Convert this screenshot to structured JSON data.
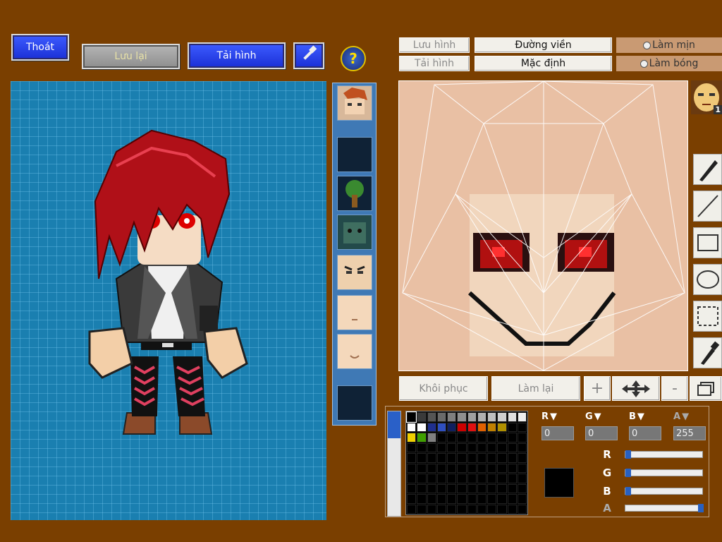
{
  "top_buttons": {
    "exit": "Thoát",
    "save": "Lưu lại",
    "load": "Tải hình",
    "help_symbol": "?"
  },
  "editor_buttons": {
    "save_image": "Lưu hình",
    "load_image": "Tải hình",
    "outline": "Đường viền",
    "default": "Mặc định",
    "smooth": "Làm mịn",
    "shiny": "Làm bóng"
  },
  "bottom_buttons": {
    "restore": "Khôi phục",
    "redo": "Làm lại",
    "zoom_in": "+",
    "zoom_out": "-"
  },
  "avatar_badge": "1",
  "color": {
    "channels": [
      {
        "label": "R",
        "value": "0"
      },
      {
        "label": "G",
        "value": "0"
      },
      {
        "label": "B",
        "value": "0"
      },
      {
        "label": "A",
        "value": "255"
      }
    ],
    "slider_levels": {
      "R": 0.0,
      "G": 0.0,
      "B": 0.0,
      "A": 1.0
    },
    "current_color": "#000000",
    "palette": [
      "#000000",
      "#3a3a3a",
      "#555555",
      "#6a6a6a",
      "#7f7f7f",
      "#8f8f8f",
      "#a0a0a0",
      "#b0b0b0",
      "#bfbfbf",
      "#cfcfcf",
      "#dfdfdf",
      "#efefef",
      "#ffffff",
      "#ffffff",
      "#1f2f8f",
      "#2f4fbf",
      "#0f1f5f",
      "#cc0000",
      "#e01010",
      "#e06000",
      "#c08000",
      "#b09000",
      "#000000",
      "#000000",
      "#f0d000",
      "#40a000",
      "#808080"
    ]
  },
  "colors": {
    "background": "#7a3f00",
    "accent_blue": "#2a44e8"
  }
}
